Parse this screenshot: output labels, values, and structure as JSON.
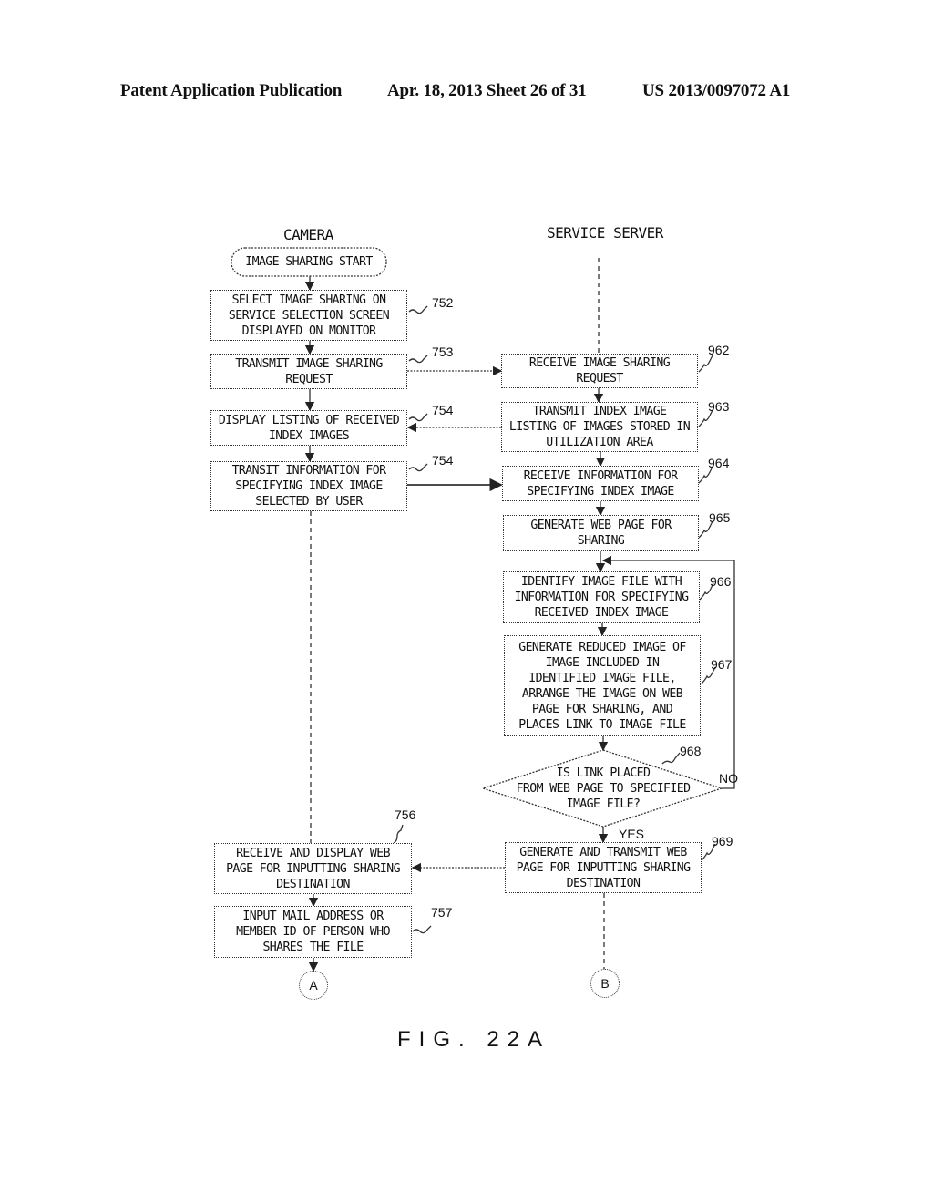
{
  "header": {
    "publication": "Patent Application Publication",
    "date_sheet": "Apr. 18, 2013  Sheet 26 of 31",
    "patent_number": "US 2013/0097072 A1"
  },
  "lanes": {
    "camera": "CAMERA",
    "server": "SERVICE SERVER"
  },
  "camera_steps": {
    "start": "IMAGE SHARING START",
    "s752": {
      "text": "SELECT IMAGE SHARING ON\nSERVICE SELECTION SCREEN\nDISPLAYED ON MONITOR",
      "ref": "752"
    },
    "s753": {
      "text": "TRANSMIT IMAGE SHARING\nREQUEST",
      "ref": "753"
    },
    "s754a": {
      "text": "DISPLAY LISTING OF RECEIVED\nINDEX IMAGES",
      "ref": "754"
    },
    "s754b": {
      "text": "TRANSIT INFORMATION FOR\nSPECIFYING INDEX IMAGE\nSELECTED BY USER",
      "ref": "754"
    },
    "s756": {
      "text": "RECEIVE AND DISPLAY WEB\nPAGE FOR INPUTTING SHARING\nDESTINATION",
      "ref": "756"
    },
    "s757": {
      "text": "INPUT MAIL ADDRESS OR\nMEMBER ID OF PERSON WHO\nSHARES THE FILE",
      "ref": "757"
    },
    "connector": "A"
  },
  "server_steps": {
    "s962": {
      "text": "RECEIVE IMAGE SHARING\nREQUEST",
      "ref": "962"
    },
    "s963": {
      "text": "TRANSMIT INDEX IMAGE\nLISTING OF IMAGES STORED IN\nUTILIZATION AREA",
      "ref": "963"
    },
    "s964": {
      "text": "RECEIVE INFORMATION FOR\nSPECIFYING INDEX IMAGE",
      "ref": "964"
    },
    "s965": {
      "text": "GENERATE WEB PAGE FOR\nSHARING",
      "ref": "965"
    },
    "s966": {
      "text": "IDENTIFY IMAGE FILE WITH\nINFORMATION FOR SPECIFYING\nRECEIVED INDEX IMAGE",
      "ref": "966"
    },
    "s967": {
      "text": "GENERATE REDUCED IMAGE OF\nIMAGE INCLUDED IN\nIDENTIFIED IMAGE FILE,\nARRANGE THE IMAGE ON WEB\nPAGE FOR SHARING, AND\nPLACES LINK TO IMAGE FILE",
      "ref": "967"
    },
    "s968": {
      "text": "IS LINK PLACED\nFROM WEB PAGE TO SPECIFIED\nIMAGE FILE?",
      "ref": "968",
      "yes": "YES",
      "no": "NO"
    },
    "s969": {
      "text": "GENERATE AND TRANSMIT WEB\nPAGE FOR INPUTTING SHARING\nDESTINATION",
      "ref": "969"
    },
    "connector": "B"
  },
  "figure_label": "FIG. 22A"
}
